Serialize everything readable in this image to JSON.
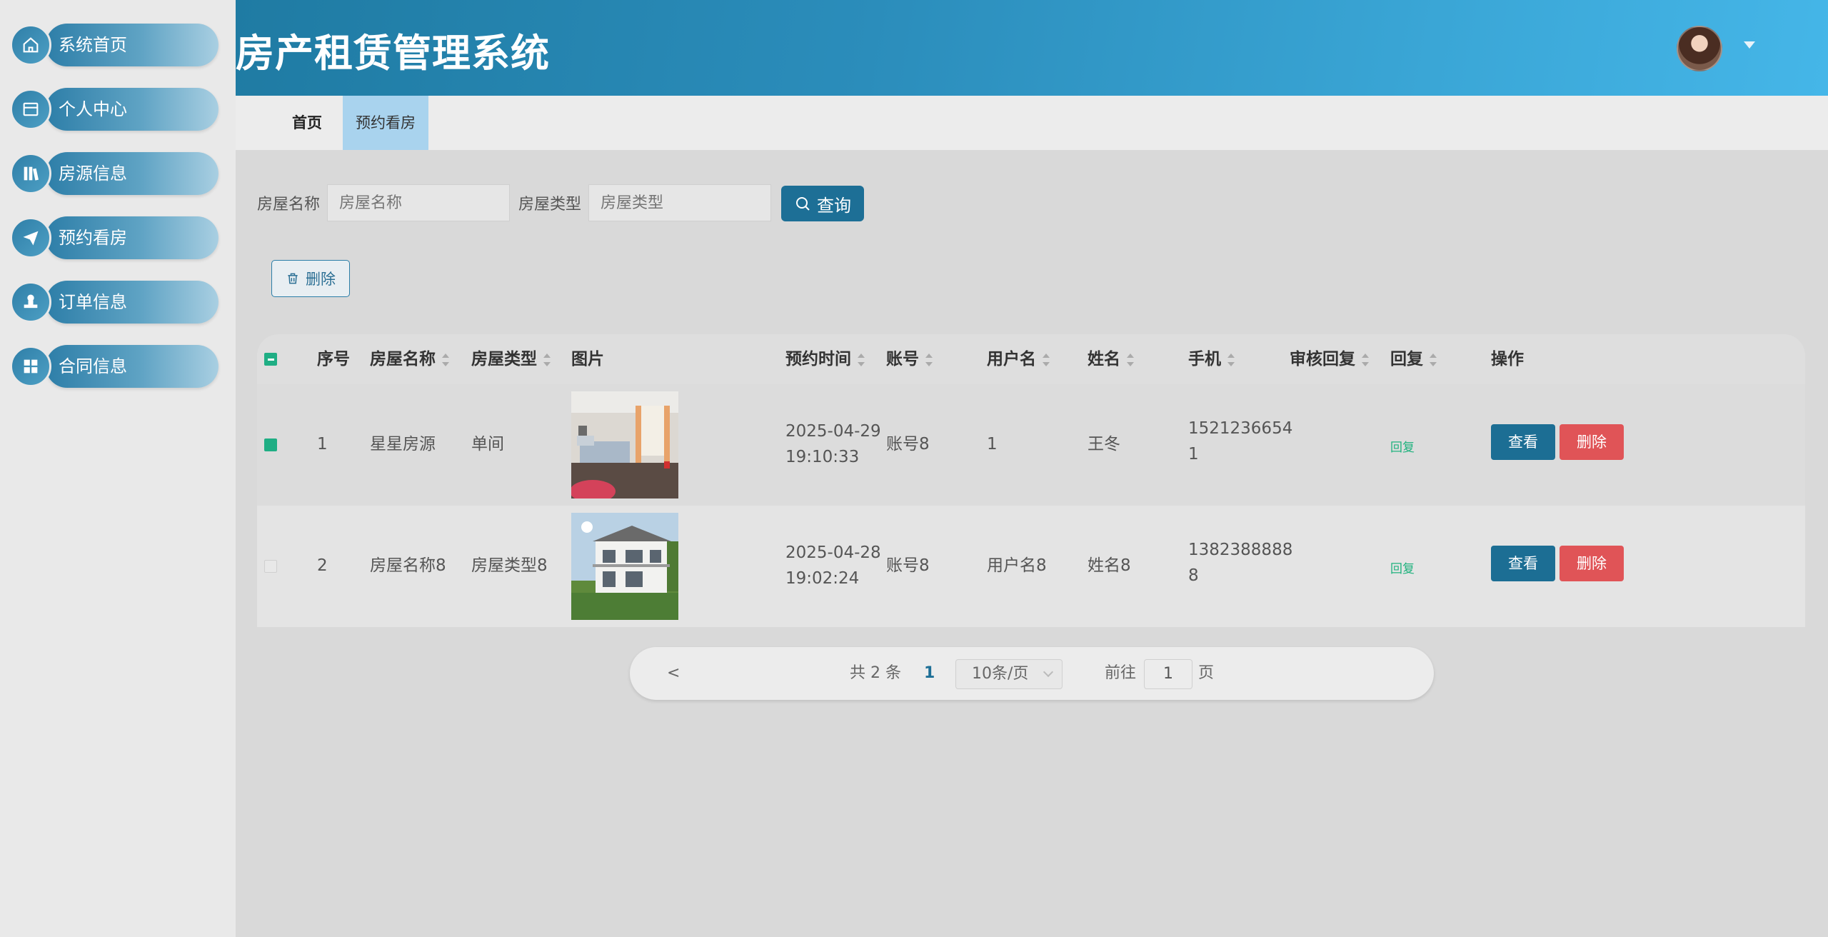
{
  "sidebar": {
    "items": [
      {
        "label": "系统首页",
        "icon": "home-icon"
      },
      {
        "label": "个人中心",
        "icon": "card-icon"
      },
      {
        "label": "房源信息",
        "icon": "books-icon"
      },
      {
        "label": "预约看房",
        "icon": "send-icon"
      },
      {
        "label": "订单信息",
        "icon": "stamp-icon"
      },
      {
        "label": "合同信息",
        "icon": "grid-icon"
      }
    ]
  },
  "header": {
    "title": "房产租赁管理系统"
  },
  "tabs": {
    "home": "首页",
    "active": "预约看房"
  },
  "search": {
    "name_label": "房屋名称",
    "name_placeholder": "房屋名称",
    "type_label": "房屋类型",
    "type_placeholder": "房屋类型",
    "button": "查询"
  },
  "actions": {
    "delete": "删除"
  },
  "table": {
    "headers": {
      "index": "序号",
      "house_name": "房屋名称",
      "house_type": "房屋类型",
      "image": "图片",
      "time": "预约时间",
      "account": "账号",
      "username": "用户名",
      "name": "姓名",
      "phone": "手机",
      "review": "审核回复",
      "reply": "回复",
      "ops": "操作"
    },
    "rows": [
      {
        "index": "1",
        "house_name": "星星房源",
        "house_type": "单间",
        "time_date": "2025-04-29",
        "time_clock": "19:10:33",
        "account": "账号8",
        "username": "1",
        "name": "王冬",
        "phone_a": "1521236654",
        "phone_b": "1",
        "review": "",
        "reply": "回复",
        "view": "查看",
        "del": "删除",
        "checked": true
      },
      {
        "index": "2",
        "house_name": "房屋名称8",
        "house_type": "房屋类型8",
        "time_date": "2025-04-28",
        "time_clock": "19:02:24",
        "account": "账号8",
        "username": "用户名8",
        "name": "姓名8",
        "phone_a": "1382388888",
        "phone_b": "8",
        "review": "",
        "reply": "回复",
        "view": "查看",
        "del": "删除",
        "checked": false
      }
    ]
  },
  "pagination": {
    "prev": "<",
    "total": "共 2 条",
    "current": "1",
    "page_size": "10条/页",
    "goto_label": "前往",
    "goto_value": "1",
    "page_suffix": "页"
  },
  "colors": {
    "primary": "#1d6f96",
    "danger": "#e05457",
    "checkbox": "#1fae84",
    "tab_active": "#a9d3ee"
  }
}
